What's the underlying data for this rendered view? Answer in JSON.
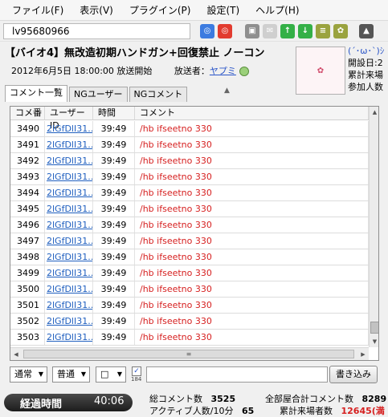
{
  "menu": [
    "ファイル(F)",
    "表示(V)",
    "プラグイン(P)",
    "設定(T)",
    "ヘルプ(H)"
  ],
  "toolbar": {
    "live_id": "lv95680966"
  },
  "program": {
    "title": "【バイオ4】無改造初期ハンドガン+回復禁止 ノーコン",
    "date": "2012年6月5日 18:00:00 放送開始",
    "caster_label": "放送者：",
    "caster_name": "ヤプミ"
  },
  "side_info": {
    "face": "(´･ω･`)ｼ",
    "line1": "開設日:2",
    "line2": "累計来場",
    "line3": "参加人数"
  },
  "tabs": [
    "コメント一覧",
    "NGユーザー",
    "NGコメント"
  ],
  "grid": {
    "headers": [
      "コメ番",
      "ユーザーID",
      "時間",
      "コメント"
    ],
    "rows": [
      {
        "no": "3490",
        "uid": "2lGfDlI31...",
        "time": "39:49",
        "comment": "/hb ifseetno 330"
      },
      {
        "no": "3491",
        "uid": "2lGfDlI31...",
        "time": "39:49",
        "comment": "/hb ifseetno 330"
      },
      {
        "no": "3492",
        "uid": "2lGfDlI31...",
        "time": "39:49",
        "comment": "/hb ifseetno 330"
      },
      {
        "no": "3493",
        "uid": "2lGfDlI31...",
        "time": "39:49",
        "comment": "/hb ifseetno 330"
      },
      {
        "no": "3494",
        "uid": "2lGfDlI31...",
        "time": "39:49",
        "comment": "/hb ifseetno 330"
      },
      {
        "no": "3495",
        "uid": "2lGfDlI31...",
        "time": "39:49",
        "comment": "/hb ifseetno 330"
      },
      {
        "no": "3496",
        "uid": "2lGfDlI31...",
        "time": "39:49",
        "comment": "/hb ifseetno 330"
      },
      {
        "no": "3497",
        "uid": "2lGfDlI31...",
        "time": "39:49",
        "comment": "/hb ifseetno 330"
      },
      {
        "no": "3498",
        "uid": "2lGfDlI31...",
        "time": "39:49",
        "comment": "/hb ifseetno 330"
      },
      {
        "no": "3499",
        "uid": "2lGfDlI31...",
        "time": "39:49",
        "comment": "/hb ifseetno 330"
      },
      {
        "no": "3500",
        "uid": "2lGfDlI31...",
        "time": "39:49",
        "comment": "/hb ifseetno 330"
      },
      {
        "no": "3501",
        "uid": "2lGfDlI31...",
        "time": "39:49",
        "comment": "/hb ifseetno 330"
      },
      {
        "no": "3502",
        "uid": "2lGfDlI31...",
        "time": "39:49",
        "comment": "/hb ifseetno 330"
      },
      {
        "no": "3503",
        "uid": "2lGfDlI31...",
        "time": "39:49",
        "comment": "/hb ifseetno 330"
      }
    ]
  },
  "input": {
    "position": "通常",
    "size": "普通",
    "color": "□",
    "char_count": "184",
    "send": "書き込み"
  },
  "status": {
    "elapsed_label": "経過時間",
    "elapsed_value": "40:06",
    "total_comments_label": "総コメント数",
    "total_comments": "3525",
    "active_label": "アクティブ人数/10分",
    "active": "65",
    "all_room_label": "全部屋合計コメント数",
    "all_room": "8289",
    "visitors_label": "累計来場者数",
    "visitors": "12645(満"
  }
}
